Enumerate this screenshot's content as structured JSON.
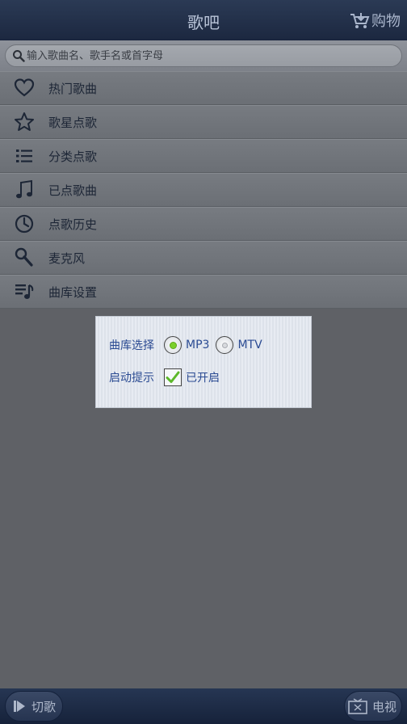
{
  "header": {
    "title": "歌吧",
    "shop_label": "购物"
  },
  "search": {
    "placeholder": "输入歌曲名、歌手名或首字母"
  },
  "menu": {
    "items": [
      {
        "label": "热门歌曲",
        "icon": "heart-icon"
      },
      {
        "label": "歌星点歌",
        "icon": "star-icon"
      },
      {
        "label": "分类点歌",
        "icon": "list-icon"
      },
      {
        "label": "已点歌曲",
        "icon": "music-note-icon"
      },
      {
        "label": "点歌历史",
        "icon": "clock-icon"
      },
      {
        "label": "麦克风",
        "icon": "microphone-icon"
      },
      {
        "label": "曲库设置",
        "icon": "playlist-settings-icon"
      }
    ]
  },
  "dialog": {
    "library_label": "曲库选择",
    "option_mp3": "MP3",
    "option_mtv": "MTV",
    "selected": "MP3",
    "startup_label": "启动提示",
    "startup_value": "已开启",
    "startup_checked": true
  },
  "footer": {
    "switch_song": "切歌",
    "tv": "电视"
  },
  "colors": {
    "header_bg": "#1c2840",
    "menu_bg": "#72767c",
    "dialog_text": "#2a4a92",
    "radio_active": "#7bd02a"
  }
}
